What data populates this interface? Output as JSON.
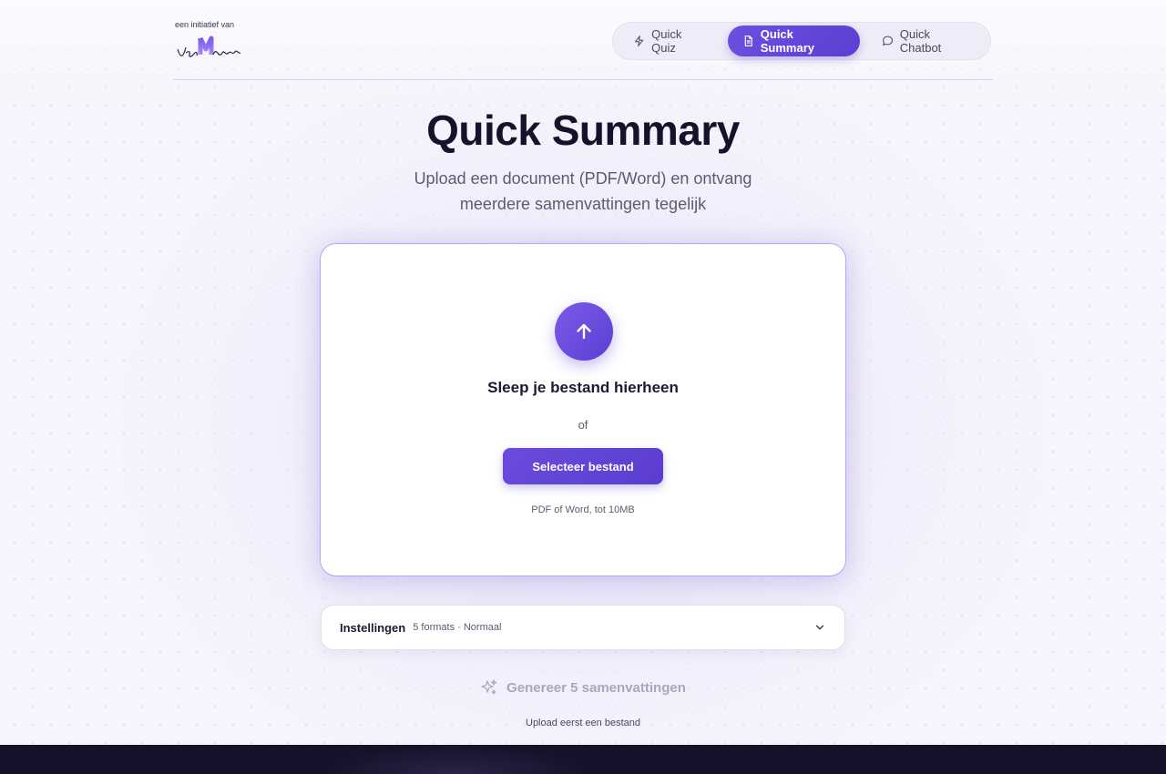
{
  "header": {
    "logo_tagline": "een initiatief van",
    "logo_icon": "voor-docenten-logo",
    "nav": [
      {
        "label": "Quick Quiz",
        "icon": "lightning-icon",
        "active": false
      },
      {
        "label": "Quick Summary",
        "icon": "document-icon",
        "active": true
      },
      {
        "label": "Quick Chatbot",
        "icon": "chat-bubble-icon",
        "active": false
      }
    ]
  },
  "hero": {
    "title": "Quick Summary",
    "subtitle": "Upload een document (PDF/Word) en ontvang meerdere samenvattingen tegelijk"
  },
  "upload": {
    "icon": "arrow-up-icon",
    "title": "Sleep je bestand hierheen",
    "or": "of",
    "button_label": "Selecteer bestand",
    "hint": "PDF of Word, tot 10MB"
  },
  "settings": {
    "label": "Instellingen",
    "meta": "5 formats · Normaal",
    "icon": "chevron-down-icon"
  },
  "generate": {
    "label": "Genereer 5 samenvattingen",
    "icon": "sparkles-icon",
    "disabled": true,
    "hint": "Upload eerst een bestand"
  },
  "colors": {
    "accent": "#5b3fd3",
    "text": "#15122b",
    "muted": "#5f5a73",
    "background": "#f6f5fb",
    "footer": "#15122a"
  }
}
